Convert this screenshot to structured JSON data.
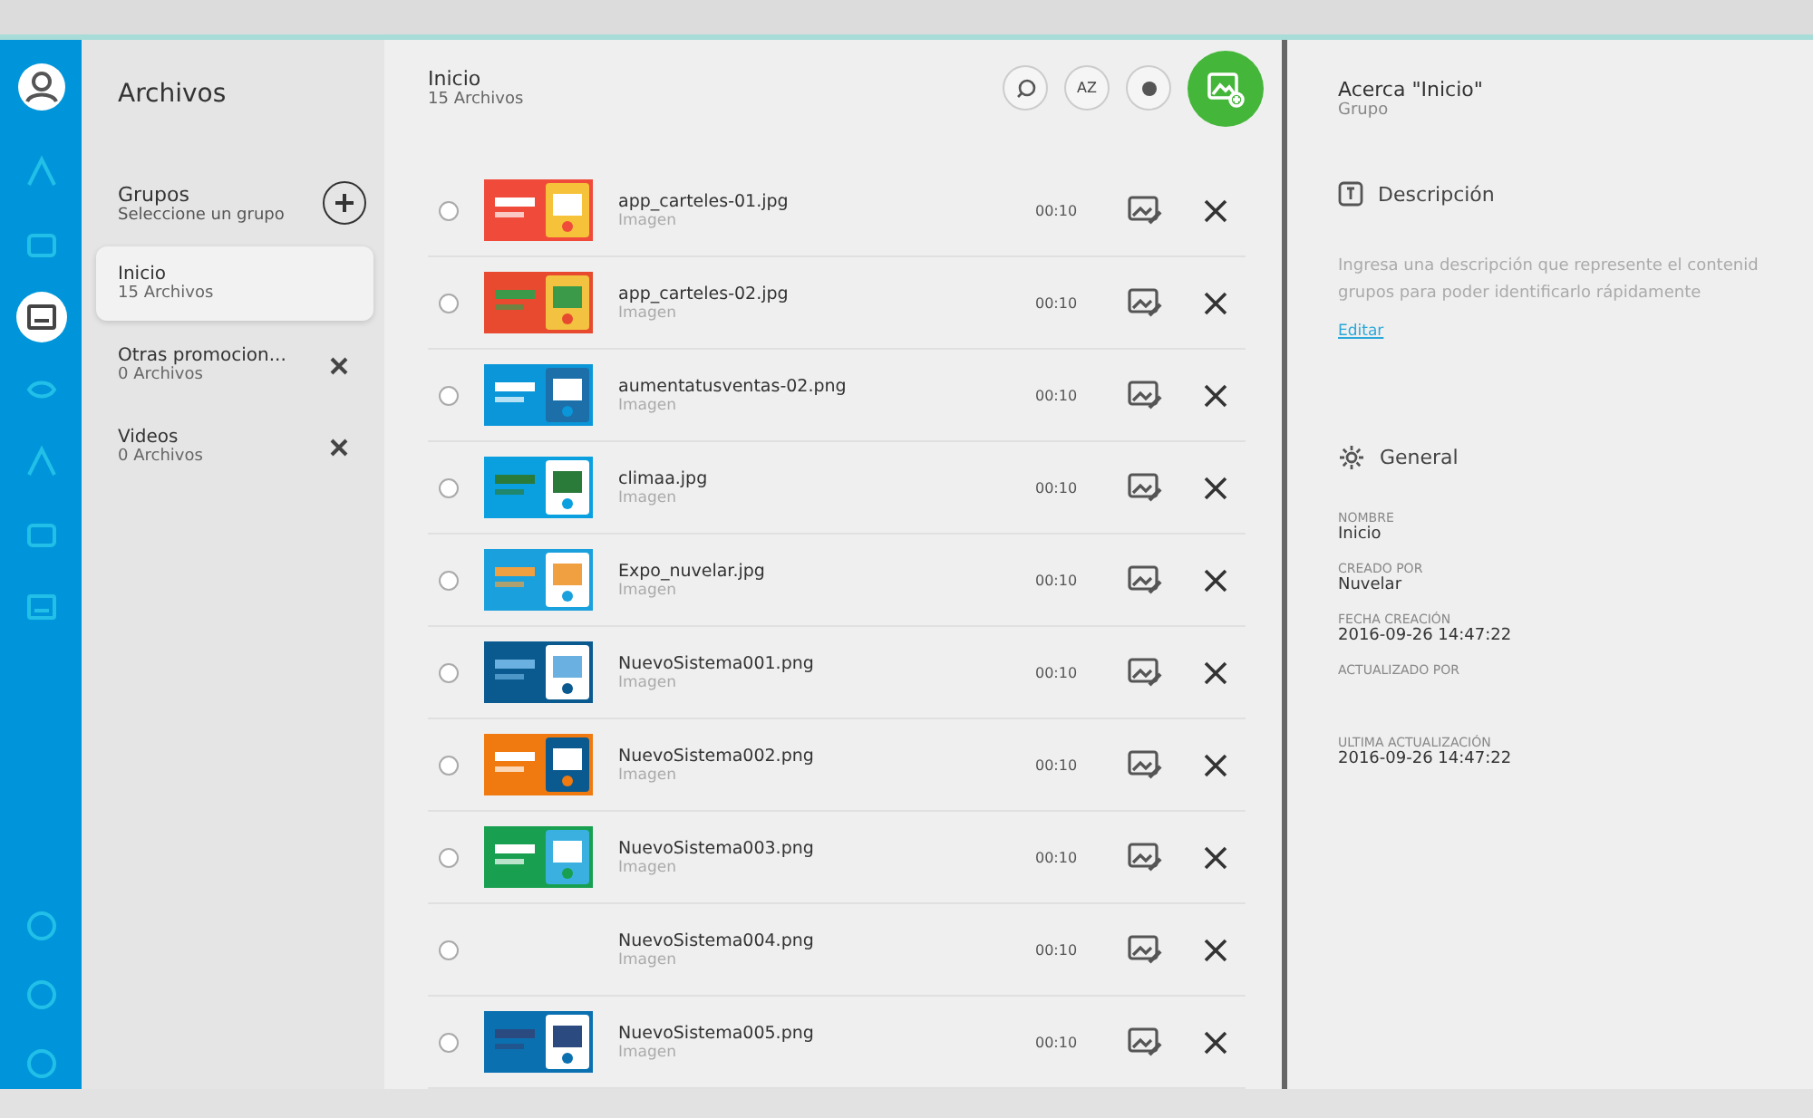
{
  "nav_rail": {
    "top": [
      {
        "selected": false
      },
      {
        "selected": false
      },
      {
        "selected": true
      },
      {
        "selected": false
      },
      {
        "selected": false
      },
      {
        "selected": false
      },
      {
        "selected": false
      }
    ],
    "bottom": [
      {
        "selected": false
      },
      {
        "selected": false
      },
      {
        "selected": false
      }
    ]
  },
  "groups_panel": {
    "title": "Archivos",
    "header": {
      "title": "Grupos",
      "subtitle": "Seleccione un grupo"
    },
    "groups": [
      {
        "name": "Inicio",
        "count": "15 Archivos",
        "selected": true,
        "removable": false
      },
      {
        "name": "Otras promocion...",
        "count": "0 Archivos",
        "selected": false,
        "removable": true
      },
      {
        "name": "Videos",
        "count": "0 Archivos",
        "selected": false,
        "removable": true
      }
    ]
  },
  "file_list": {
    "title": "Inicio",
    "subtitle": "15 Archivos",
    "sort_label": "AZ",
    "files": [
      {
        "name": "app_carteles-01.jpg",
        "type": "Imagen",
        "duration": "00:10",
        "selected": false,
        "kind": "picture"
      },
      {
        "name": "app_carteles-02.jpg",
        "type": "Imagen",
        "duration": "00:10",
        "selected": false,
        "kind": "picture"
      },
      {
        "name": "aumentatusventas-02.png",
        "type": "Imagen",
        "duration": "00:10",
        "selected": false,
        "kind": "picture"
      },
      {
        "name": "climaa.jpg",
        "type": "Imagen",
        "duration": "00:10",
        "selected": false,
        "kind": "picture"
      },
      {
        "name": "Expo_nuvelar.jpg",
        "type": "Imagen",
        "duration": "00:10",
        "selected": false,
        "kind": "picture"
      },
      {
        "name": "NuevoSistema001.png",
        "type": "Imagen",
        "duration": "00:10",
        "selected": false,
        "kind": "picture"
      },
      {
        "name": "NuevoSistema002.png",
        "type": "Imagen",
        "duration": "00:10",
        "selected": false,
        "kind": "picture"
      },
      {
        "name": "NuevoSistema003.png",
        "type": "Imagen",
        "duration": "00:10",
        "selected": false,
        "kind": "picture"
      },
      {
        "name": "NuevoSistema004.png",
        "type": "Imagen",
        "duration": "00:10",
        "selected": false,
        "kind": "blank"
      },
      {
        "name": "NuevoSistema005.png",
        "type": "Imagen",
        "duration": "00:10",
        "selected": false,
        "kind": "picture"
      }
    ]
  },
  "details": {
    "title": "Acerca \"Inicio\"",
    "subtitle": "Grupo",
    "description": {
      "heading": "Descripción",
      "lines": [
        "Ingresa una descripción que represente el contenid",
        "grupos para poder identificarlo rápidamente"
      ],
      "link": "Editar"
    },
    "general": {
      "heading": "General",
      "fields": [
        {
          "label": "NOMBRE",
          "value": "Inicio"
        },
        {
          "label": "CREADO POR",
          "value": "Nuvelar"
        },
        {
          "label": "FECHA CREACIÓN",
          "value": "2016-09-26 14:47:22"
        },
        {
          "label": "ACTUALIZADO POR"
        },
        {
          "label": "ULTIMA ACTUALIZACIÓN",
          "value": "2016-09-26 14:47:22"
        }
      ]
    }
  }
}
